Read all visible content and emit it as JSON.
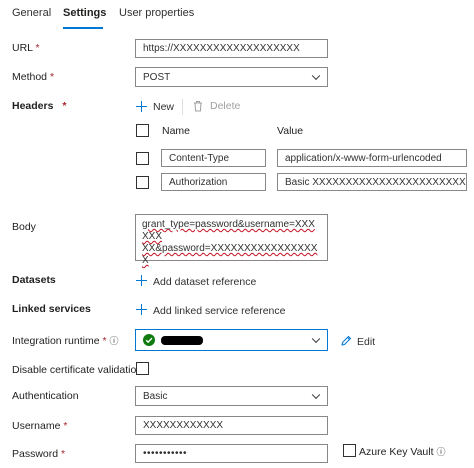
{
  "tabs": [
    {
      "label": "General"
    },
    {
      "label": "Settings"
    },
    {
      "label": "User properties"
    }
  ],
  "url": {
    "label": "URL",
    "required": "*",
    "value": "https://XXXXXXXXXXXXXXXXXXX"
  },
  "method": {
    "label": "Method",
    "required": "*",
    "value": "POST"
  },
  "headers": {
    "label": "Headers",
    "required": "*",
    "new_label": "New",
    "delete_label": "Delete",
    "col_name": "Name",
    "col_value": "Value",
    "rows": [
      {
        "name": "Content-Type",
        "value": "application/x-www-form-urlencoded"
      },
      {
        "name": "Authorization",
        "value": "Basic XXXXXXXXXXXXXXXXXXXXXXXXXX"
      }
    ]
  },
  "body": {
    "label": "Body",
    "line1": "grant_type=password&username=XXXXXX",
    "line2": "XX&password=XXXXXXXXXXXXXXXXX"
  },
  "datasets": {
    "label": "Datasets",
    "add_label": "Add dataset reference"
  },
  "linked_services": {
    "label": "Linked services",
    "add_label": "Add linked service reference"
  },
  "integration_runtime": {
    "label": "Integration runtime",
    "required": "*",
    "info": "ⓘ",
    "edit_label": "Edit",
    "status_color": "#107c10"
  },
  "disable_cert": {
    "label": "Disable certificate validation"
  },
  "authentication": {
    "label": "Authentication",
    "value": "Basic"
  },
  "username": {
    "label": "Username",
    "required": "*",
    "value": "XXXXXXXXXXXX"
  },
  "password": {
    "label": "Password",
    "required": "*",
    "value": "•••••••••••",
    "akv_label": "Azure Key Vault",
    "info": "ⓘ"
  },
  "colors": {
    "accent": "#0078d4",
    "required": "#a4262c"
  }
}
